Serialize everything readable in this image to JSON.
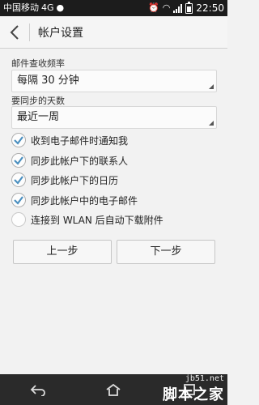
{
  "status_bar": {
    "carrier": "中国移动",
    "network": "4G",
    "time": "22:50"
  },
  "action_bar": {
    "title": "帐户设置"
  },
  "check_frequency": {
    "label": "邮件查收频率",
    "value": "每隔 30 分钟"
  },
  "sync_days": {
    "label": "要同步的天数",
    "value": "最近一周"
  },
  "options": [
    {
      "label": "收到电子邮件时通知我",
      "checked": true
    },
    {
      "label": "同步此帐户下的联系人",
      "checked": true
    },
    {
      "label": "同步此帐户下的日历",
      "checked": true
    },
    {
      "label": "同步此帐户中的电子邮件",
      "checked": true
    },
    {
      "label": "连接到 WLAN 后自动下载附件",
      "checked": false
    }
  ],
  "buttons": {
    "previous": "上一步",
    "next": "下一步"
  },
  "watermark": {
    "url": "jb51.net",
    "name": "脚本之家"
  },
  "colors": {
    "check_accent": "#4a8fbf",
    "status_bar": "#1c1c1c",
    "nav_bar": "#2a2a2a"
  }
}
